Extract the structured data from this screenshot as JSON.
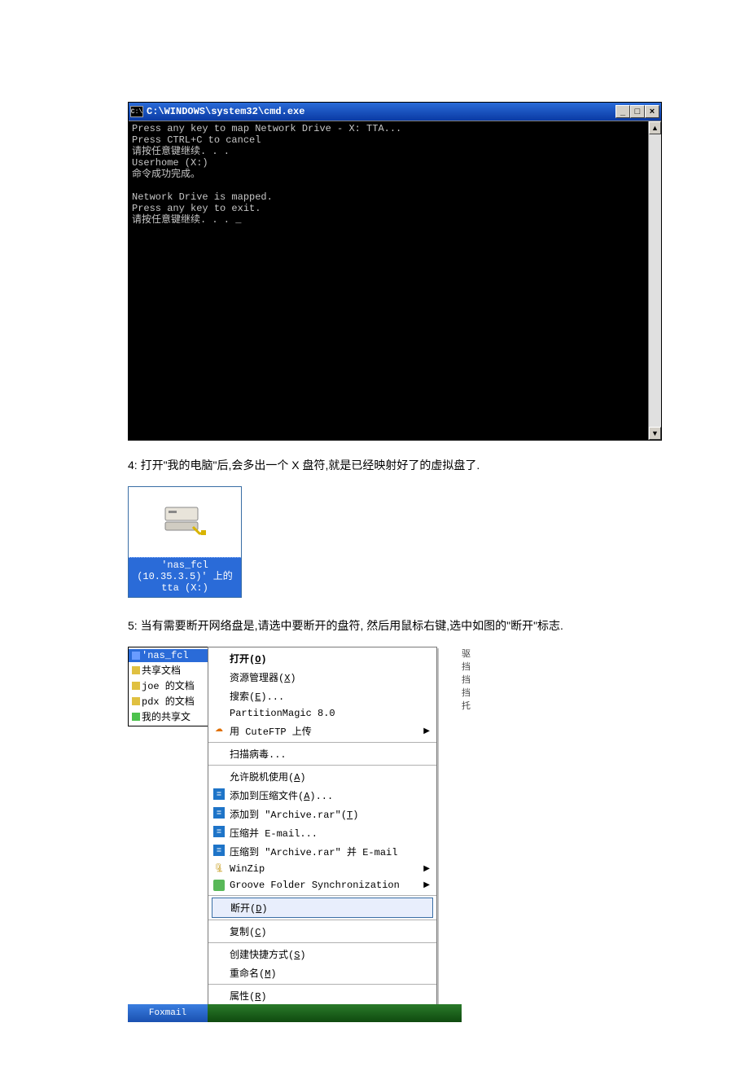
{
  "cmd": {
    "title": "C:\\WINDOWS\\system32\\cmd.exe",
    "body": "Press any key to map Network Drive - X: TTA...\nPress CTRL+C to cancel\n请按任意键继续. . .\nUserhome (X:)\n命令成功完成。\n\nNetwork Drive is mapped.\nPress any key to exit.\n请按任意键继续. . . _"
  },
  "step4": "4:  打开\"我的电脑\"后,会多出一个 X 盘符,就是已经映射好了的虚拟盘了.",
  "drive": {
    "line1": "'nas_fcl",
    "line2": "(10.35.3.5)' 上的",
    "line3": "tta (X:)"
  },
  "step5": "5:  当有需要断开网络盘是,请选中要断开的盘符, 然后用鼠标右键,选中如图的\"断开\"标志.",
  "sidebar": {
    "items": [
      {
        "label": "'nas_fcl",
        "sel": true,
        "ico": "blue"
      },
      {
        "label": "共享文档",
        "ico": "y"
      },
      {
        "label": "joe 的文档",
        "ico": "y"
      },
      {
        "label": "pdx 的文档",
        "ico": "y"
      },
      {
        "label": "我的共享文",
        "ico": "green"
      }
    ]
  },
  "menu": {
    "s1": [
      {
        "label": "打开(O)",
        "bold": true
      },
      {
        "label": "资源管理器(X)"
      },
      {
        "label": "搜索(E)..."
      },
      {
        "label": "PartitionMagic 8.0"
      },
      {
        "label": "用 CuteFTP 上传",
        "icon": "ftp",
        "sub": true
      }
    ],
    "s2": [
      {
        "label": "扫描病毒..."
      }
    ],
    "s3": [
      {
        "label": "允许脱机使用(A)"
      },
      {
        "label": "添加到压缩文件(A)...",
        "icon": "rar"
      },
      {
        "label": "添加到 \"Archive.rar\"(T)",
        "icon": "rar"
      },
      {
        "label": "压缩并 E-mail...",
        "icon": "rar"
      },
      {
        "label": "压缩到 \"Archive.rar\" 并 E-mail",
        "icon": "rar"
      },
      {
        "label": "WinZip",
        "icon": "wz",
        "sub": true
      },
      {
        "label": "Groove Folder Synchronization",
        "icon": "gr",
        "sub": true
      }
    ],
    "s4": [
      {
        "label": "断开(D)",
        "hl": true
      }
    ],
    "s5": [
      {
        "label": "复制(C)"
      }
    ],
    "s6": [
      {
        "label": "创建快捷方式(S)"
      },
      {
        "label": "重命名(M)"
      }
    ],
    "s7": [
      {
        "label": "属性(R)"
      }
    ]
  },
  "taskbar_label": "Foxmail"
}
